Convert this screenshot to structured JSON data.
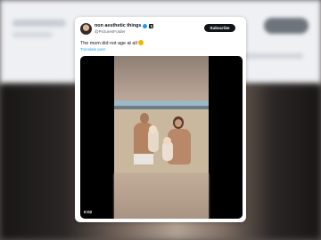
{
  "post": {
    "display_name": "non aesthetic things",
    "handle": "@PicturesFoIder",
    "subscribe_label": "Subscribe",
    "text": "The mom did not age at all",
    "translate_label": "Translate post",
    "video": {
      "elapsed": "0:02"
    }
  },
  "colors": {
    "verified": "#1d9bf0",
    "subscribe_bg": "#0f1419",
    "link": "#1d9bf0"
  },
  "icons": {
    "verified": "verified-badge-icon",
    "x_logo": "x-logo-icon",
    "emoji": "smiling-face-emoji"
  }
}
